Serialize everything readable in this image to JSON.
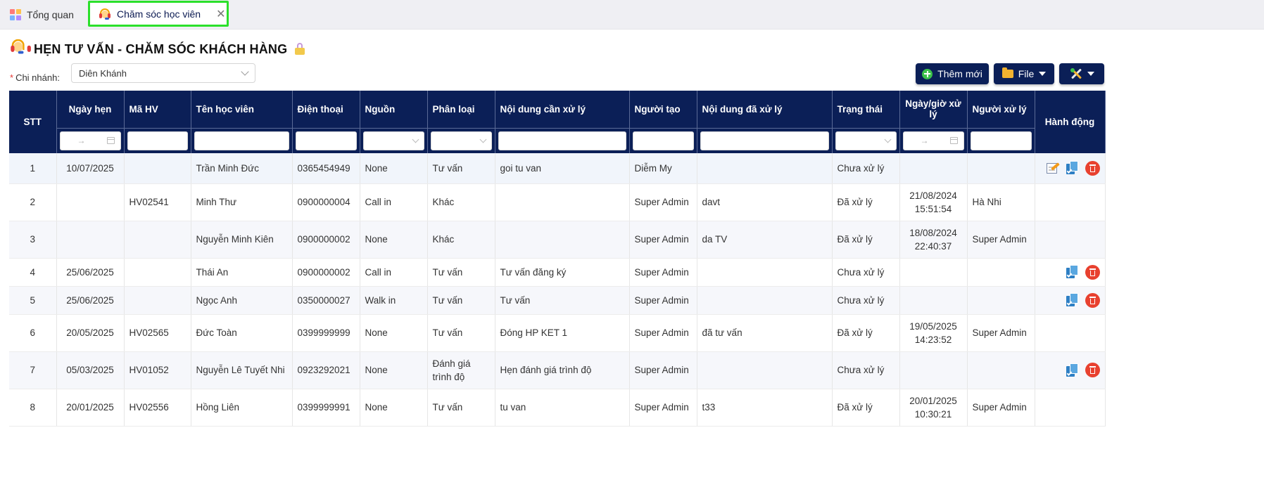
{
  "tabs": [
    {
      "label": "Tổng quan"
    },
    {
      "label": "Chăm sóc học viên"
    }
  ],
  "page": {
    "title": "HẸN TƯ VẤN - CHĂM SÓC KHÁCH HÀNG"
  },
  "branch": {
    "label": "Chi nhánh:",
    "value": "Diên Khánh"
  },
  "toolbar": {
    "add_label": "Thêm mới",
    "file_label": "File"
  },
  "table": {
    "columns": [
      "STT",
      "Ngày hẹn",
      "Mã HV",
      "Tên học viên",
      "Điện thoại",
      "Nguồn",
      "Phân loại",
      "Nội dung cần xử lý",
      "Người tạo",
      "Nội dung đã xử lý",
      "Trạng thái",
      "Ngày/giờ xử lý",
      "Người xử lý",
      "Hành động"
    ],
    "rows": [
      {
        "stt": "1",
        "date": "10/07/2025",
        "code": "",
        "name": "Trần Minh Đức",
        "phone": "0365454949",
        "source": "None",
        "type": "Tư vấn",
        "todo": "goi tu van",
        "creator": "Diễm My",
        "done": "",
        "status": "Chưa xử lý",
        "handled_date": "",
        "handled_time": "",
        "handler": ""
      },
      {
        "stt": "2",
        "date": "",
        "code": "HV02541",
        "name": "Minh Thư",
        "phone": "0900000004",
        "source": "Call in",
        "type": "Khác",
        "todo": "",
        "creator": "Super Admin",
        "done": "davt",
        "status": "Đã xử lý",
        "handled_date": "21/08/2024",
        "handled_time": "15:51:54",
        "handler": "Hà Nhi"
      },
      {
        "stt": "3",
        "date": "",
        "code": "",
        "name": "Nguyễn Minh Kiên",
        "phone": "0900000002",
        "source": "None",
        "type": "Khác",
        "todo": "",
        "creator": "Super Admin",
        "done": "da TV",
        "status": "Đã xử lý",
        "handled_date": "18/08/2024",
        "handled_time": "22:40:37",
        "handler": "Super Admin"
      },
      {
        "stt": "4",
        "date": "25/06/2025",
        "code": "",
        "name": "Thái An",
        "phone": "0900000002",
        "source": "Call in",
        "type": "Tư vấn",
        "todo": "Tư vấn đăng ký",
        "creator": "Super Admin",
        "done": "",
        "status": "Chưa xử lý",
        "handled_date": "",
        "handled_time": "",
        "handler": ""
      },
      {
        "stt": "5",
        "date": "25/06/2025",
        "code": "",
        "name": "Ngọc Anh",
        "phone": "0350000027",
        "source": "Walk in",
        "type": "Tư vấn",
        "todo": "Tư vấn",
        "creator": "Super Admin",
        "done": "",
        "status": "Chưa xử lý",
        "handled_date": "",
        "handled_time": "",
        "handler": ""
      },
      {
        "stt": "6",
        "date": "20/05/2025",
        "code": "HV02565",
        "name": "Đức Toàn",
        "phone": "0399999999",
        "source": "None",
        "type": "Tư vấn",
        "todo": "Đóng HP KET 1",
        "creator": "Super Admin",
        "done": "đã tư vấn",
        "status": "Đã xử lý",
        "handled_date": "19/05/2025",
        "handled_time": "14:23:52",
        "handler": "Super Admin"
      },
      {
        "stt": "7",
        "date": "05/03/2025",
        "code": "HV01052",
        "name": "Nguyễn Lê Tuyết Nhi",
        "phone": "0923292021",
        "source": "None",
        "type": "Đánh giá trình độ",
        "todo": "Hẹn đánh giá trình độ",
        "creator": "Super Admin",
        "done": "",
        "status": "Chưa xử lý",
        "handled_date": "",
        "handled_time": "",
        "handler": ""
      },
      {
        "stt": "8",
        "date": "20/01/2025",
        "code": "HV02556",
        "name": "Hồng Liên",
        "phone": "0399999991",
        "source": "None",
        "type": "Tư vấn",
        "todo": "tu van",
        "creator": "Super Admin",
        "done": "t33",
        "status": "Đã xử lý",
        "handled_date": "20/01/2025",
        "handled_time": "10:30:21",
        "handler": "Super Admin"
      }
    ]
  },
  "icons": {
    "overview_tab": "grid-icon",
    "care_tab": "headset-icon",
    "title": "headset-icon",
    "title_suffix": "lock-icon",
    "add": "plus-circle-icon",
    "file": "folder-icon",
    "tools": "tools-icon",
    "edit": "edit-icon",
    "process": "document-check-icon",
    "delete": "delete-icon"
  },
  "colors": {
    "header_bg": "#0b1f57",
    "active_tab_border": "#2be02b",
    "delete": "#e8412f"
  }
}
